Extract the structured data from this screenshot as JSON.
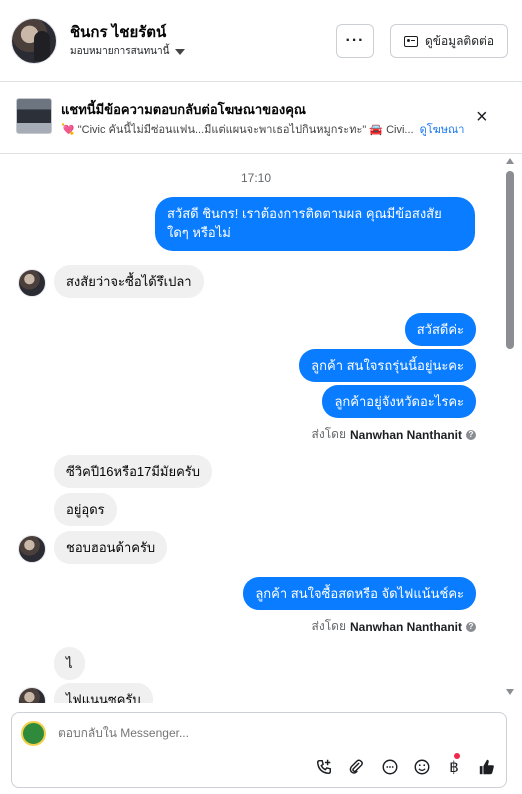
{
  "header": {
    "name": "ชินกร ไชยรัตน์",
    "assign_label": "มอบหมายการสนทนานี้",
    "more_label": "···",
    "contact_info_label": "ดูข้อมูลติดต่อ"
  },
  "ad_banner": {
    "title": "แชทนี้มีข้อความตอบกลับต่อโฆษณาของคุณ",
    "subtitle": "💘 \"Civic คันนี้ไม่มีซ่อนแฟน...มีแต่แผนจะพาเธอไปกินหมูกระทะ\" 🚘 Civi...",
    "link": "ดูโฆษณา",
    "close": "×"
  },
  "chat": {
    "timestamp": "17:10",
    "messages": [
      {
        "direction": "out",
        "text": "สวัสดี ชินกร! เราต้องการติดตามผล คุณมีข้อสงสัย"
      },
      {
        "direction": "out",
        "text": "ใดๆ หรือไม่"
      },
      {
        "direction": "in",
        "text": "สงสัยว่าจะซื้อได้รึเปลา"
      },
      {
        "direction": "out",
        "text": "สวัสดีค่ะ"
      },
      {
        "direction": "out",
        "text": "ลูกค้า  สนใจรถรุ่นนี้อยู่นะคะ"
      },
      {
        "direction": "out",
        "text": "ลูกค้าอยู่จังหวัดอะไรคะ"
      },
      {
        "direction": "in",
        "text": "ซีวิคปี16หรือ17มีมัยครับ"
      },
      {
        "direction": "in",
        "text": "อยู่อุดร"
      },
      {
        "direction": "in",
        "text": "ชอบฮอนด้าครับ"
      },
      {
        "direction": "out",
        "text": "ลูกค้า สนใจซื้อสดหรือ จัดไฟแน้นช์คะ"
      },
      {
        "direction": "in",
        "text": "ไ"
      },
      {
        "direction": "in",
        "text": "ไฟแนนซครับ"
      }
    ],
    "sent_by_prefix": "ส่งโดย",
    "sent_by_name": "Nanwhan Nanthanit",
    "info_glyph": "?"
  },
  "composer": {
    "placeholder": "ตอบกลับใน Messenger...",
    "tools": [
      "add-call-icon",
      "attachment-icon",
      "saved-reply-icon",
      "emoji-icon",
      "payment-icon",
      "like-icon"
    ]
  },
  "colors": {
    "outgoing_bubble": "#0a7cff",
    "incoming_bubble": "#f0f0f0",
    "link": "#1877f2",
    "notification_dot": "#f02849"
  }
}
